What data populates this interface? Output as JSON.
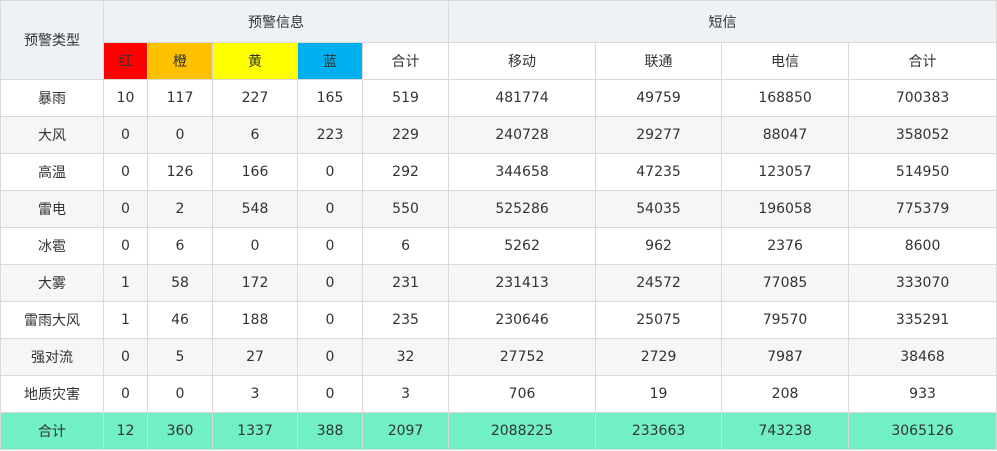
{
  "header": {
    "type_label": "预警类型",
    "warning_group": "预警信息",
    "sms_group": "短信",
    "levels": [
      {
        "label": "红",
        "color": "#ff0000"
      },
      {
        "label": "橙",
        "color": "#ffc000"
      },
      {
        "label": "黄",
        "color": "#ffff00"
      },
      {
        "label": "蓝",
        "color": "#00b0f0"
      }
    ],
    "warning_total": "合计",
    "carriers": [
      "移动",
      "联通",
      "电信"
    ],
    "sms_total": "合计"
  },
  "rows": [
    {
      "type": "暴雨",
      "values": [
        "10",
        "117",
        "227",
        "165",
        "519",
        "481774",
        "49759",
        "168850",
        "700383"
      ]
    },
    {
      "type": "大风",
      "values": [
        "0",
        "0",
        "6",
        "223",
        "229",
        "240728",
        "29277",
        "88047",
        "358052"
      ]
    },
    {
      "type": "高温",
      "values": [
        "0",
        "126",
        "166",
        "0",
        "292",
        "344658",
        "47235",
        "123057",
        "514950"
      ]
    },
    {
      "type": "雷电",
      "values": [
        "0",
        "2",
        "548",
        "0",
        "550",
        "525286",
        "54035",
        "196058",
        "775379"
      ]
    },
    {
      "type": "冰雹",
      "values": [
        "0",
        "6",
        "0",
        "0",
        "6",
        "5262",
        "962",
        "2376",
        "8600"
      ]
    },
    {
      "type": "大雾",
      "values": [
        "1",
        "58",
        "172",
        "0",
        "231",
        "231413",
        "24572",
        "77085",
        "333070"
      ]
    },
    {
      "type": "雷雨大风",
      "values": [
        "1",
        "46",
        "188",
        "0",
        "235",
        "230646",
        "25075",
        "79570",
        "335291"
      ]
    },
    {
      "type": "强对流",
      "values": [
        "0",
        "5",
        "27",
        "0",
        "32",
        "27752",
        "2729",
        "7987",
        "38468"
      ]
    },
    {
      "type": "地质灾害",
      "values": [
        "0",
        "0",
        "3",
        "0",
        "3",
        "706",
        "19",
        "208",
        "933"
      ]
    }
  ],
  "total": {
    "type": "合计",
    "values": [
      "12",
      "360",
      "1337",
      "388",
      "2097",
      "2088225",
      "233663",
      "743238",
      "3065126"
    ]
  },
  "colors": {
    "header_bg": "#eef1f6",
    "total_bg": "#70f0c4",
    "stripe_bg": "#f5f6f8",
    "border": "#d9d9d9"
  }
}
